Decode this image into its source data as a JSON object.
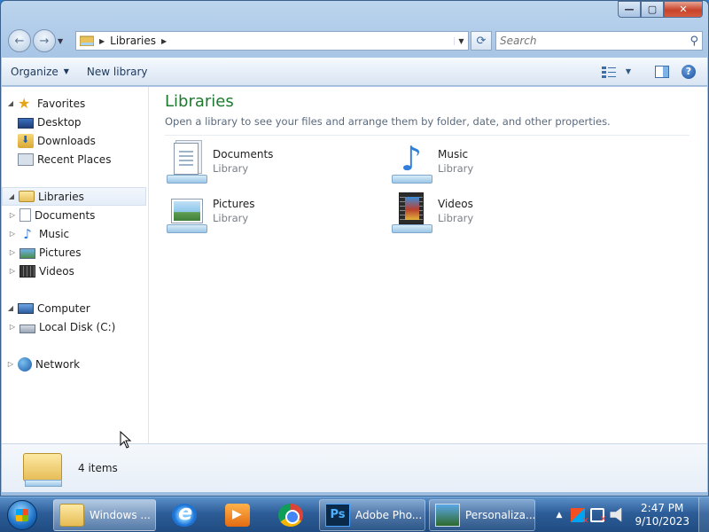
{
  "window": {
    "caption_buttons": {
      "minimize": "—",
      "maximize": "▢",
      "close": "✕"
    }
  },
  "address": {
    "back_icon": "←",
    "forward_icon": "→",
    "crumb": "Libraries",
    "search_placeholder": "Search"
  },
  "toolbar": {
    "organize_label": "Organize",
    "new_library_label": "New library",
    "help_label": "?"
  },
  "nav": {
    "favorites": {
      "label": "Favorites",
      "items": [
        "Desktop",
        "Downloads",
        "Recent Places"
      ]
    },
    "libraries": {
      "label": "Libraries",
      "items": [
        "Documents",
        "Music",
        "Pictures",
        "Videos"
      ]
    },
    "computer": {
      "label": "Computer",
      "items": [
        "Local Disk (C:)"
      ]
    },
    "network": {
      "label": "Network"
    }
  },
  "main": {
    "title": "Libraries",
    "subtitle": "Open a library to see your files and arrange them by folder, date, and other properties.",
    "libraries": [
      {
        "name": "Documents",
        "type": "Library",
        "icon": "documents-library-icon"
      },
      {
        "name": "Music",
        "type": "Library",
        "icon": "music-library-icon"
      },
      {
        "name": "Pictures",
        "type": "Library",
        "icon": "pictures-library-icon"
      },
      {
        "name": "Videos",
        "type": "Library",
        "icon": "videos-library-icon"
      }
    ]
  },
  "details": {
    "count": "4 items"
  },
  "taskbar": {
    "buttons": [
      {
        "label": "Windows ...",
        "icon": "explorer-icon"
      },
      {
        "label": "",
        "icon": "internet-explorer-icon"
      },
      {
        "label": "",
        "icon": "media-player-icon"
      },
      {
        "label": "",
        "icon": "chrome-icon"
      },
      {
        "label": "Adobe Pho...",
        "icon": "photoshop-icon",
        "badge": "Ps"
      },
      {
        "label": "Personaliza...",
        "icon": "personalization-icon"
      }
    ],
    "clock": {
      "time": "2:47 PM",
      "date": "9/10/2023"
    }
  },
  "colors": {
    "title_green": "#1e7a2e",
    "taskbar_blue": "#2d5d98"
  }
}
